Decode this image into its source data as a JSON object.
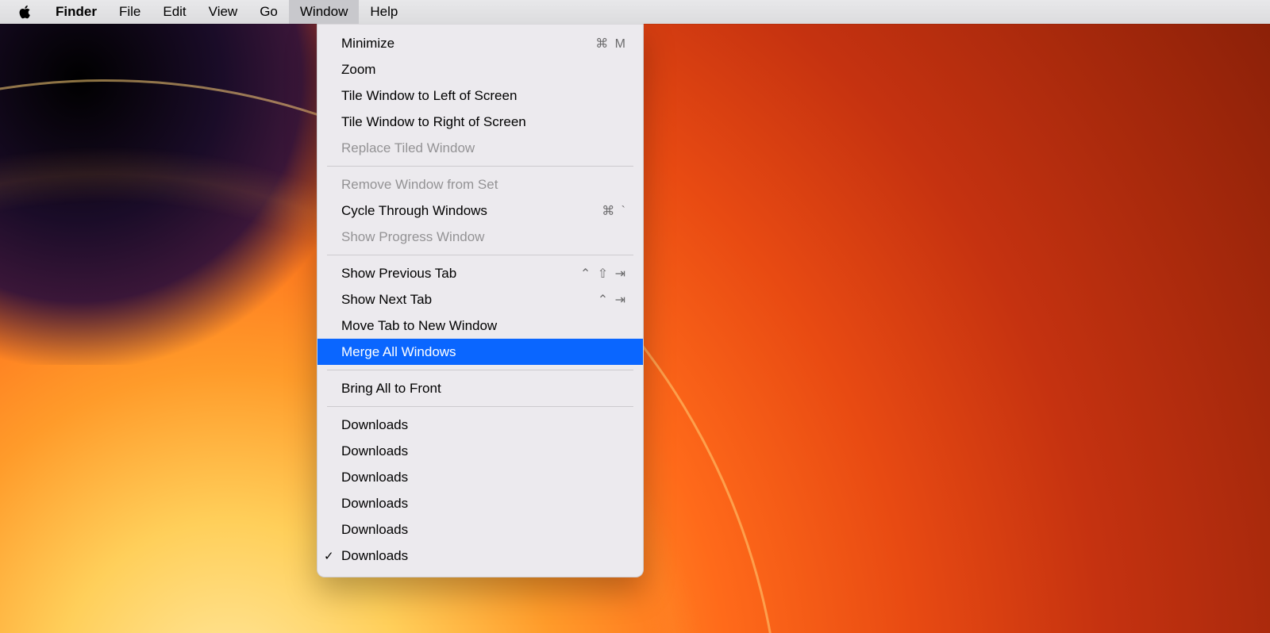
{
  "menubar": {
    "app_name": "Finder",
    "items": [
      {
        "label": "File"
      },
      {
        "label": "Edit"
      },
      {
        "label": "View"
      },
      {
        "label": "Go"
      },
      {
        "label": "Window",
        "open": true
      },
      {
        "label": "Help"
      }
    ]
  },
  "window_menu": {
    "items": [
      {
        "label": "Minimize",
        "shortcut": "⌘ M",
        "enabled": true
      },
      {
        "label": "Zoom",
        "shortcut": "",
        "enabled": true
      },
      {
        "label": "Tile Window to Left of Screen",
        "shortcut": "",
        "enabled": true
      },
      {
        "label": "Tile Window to Right of Screen",
        "shortcut": "",
        "enabled": true
      },
      {
        "label": "Replace Tiled Window",
        "shortcut": "",
        "enabled": false
      }
    ],
    "group2": [
      {
        "label": "Remove Window from Set",
        "shortcut": "",
        "enabled": false
      },
      {
        "label": "Cycle Through Windows",
        "shortcut": "⌘  `",
        "enabled": true
      },
      {
        "label": "Show Progress Window",
        "shortcut": "",
        "enabled": false
      }
    ],
    "group3": [
      {
        "label": "Show Previous Tab",
        "shortcut": "⌃ ⇧ ⇥",
        "enabled": true
      },
      {
        "label": "Show Next Tab",
        "shortcut": "⌃   ⇥",
        "enabled": true
      },
      {
        "label": "Move Tab to New Window",
        "shortcut": "",
        "enabled": true
      },
      {
        "label": "Merge All Windows",
        "shortcut": "",
        "enabled": true,
        "highlight": true
      }
    ],
    "group4": [
      {
        "label": "Bring All to Front",
        "shortcut": "",
        "enabled": true
      }
    ],
    "group5": [
      {
        "label": "Downloads",
        "shortcut": "",
        "enabled": true
      },
      {
        "label": "Downloads",
        "shortcut": "",
        "enabled": true
      },
      {
        "label": "Downloads",
        "shortcut": "",
        "enabled": true
      },
      {
        "label": "Downloads",
        "shortcut": "",
        "enabled": true
      },
      {
        "label": "Downloads",
        "shortcut": "",
        "enabled": true
      },
      {
        "label": "Downloads",
        "shortcut": "",
        "enabled": true,
        "checked": true
      }
    ]
  }
}
